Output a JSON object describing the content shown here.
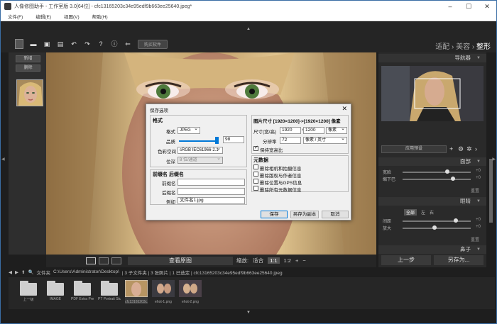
{
  "window": {
    "title": "人像修图助手 - 工作室版 3.0[64位] - cfc13165203c34e95edf9b663ee25640.jpeg*"
  },
  "menu": [
    "文件(F)",
    "编辑(E)",
    "视图(V)",
    "帮助(H)"
  ],
  "toolbar": {
    "buy_label": "购买软件"
  },
  "nav": {
    "step1": "适配",
    "sep": "›",
    "step2": "美容",
    "step3": "整形"
  },
  "left": {
    "new_label": "新增",
    "delete_label": "删除"
  },
  "view": {
    "look_label": "查看原图",
    "zoom_label": "缩放:",
    "fit": "适合",
    "one": "1:1",
    "half": "1:2",
    "plus": "+",
    "minus": "−"
  },
  "right": {
    "navigator": "导航器",
    "preset": "应用预设",
    "face": {
      "title": "面部",
      "rows": [
        {
          "label": "宽脸",
          "value": "+0"
        },
        {
          "label": "缩下巴",
          "value": "+0"
        }
      ],
      "reset": "重置"
    },
    "eyes": {
      "title": "眼睛",
      "tab_left": "左",
      "tab_right": "右",
      "tab_both": "全部",
      "rows": [
        {
          "label": "间距",
          "value": "+0"
        },
        {
          "label": "放大",
          "value": "+0"
        }
      ],
      "reset": "重置"
    },
    "nose": {
      "title": "鼻子"
    },
    "back": "上一步",
    "save": "另存为..."
  },
  "path": {
    "label": "文件夹",
    "value": "C:\\Users\\Administrator\\Desktop\\",
    "info": "| 3 子文件夹 | 3 张照片 | 1 已选定 | cfc13165203c34e95edf9b663ee25640.jpeg"
  },
  "film": [
    {
      "name": "上一级"
    },
    {
      "name": "IMAGE"
    },
    {
      "name": "PDF Extra Pre..."
    },
    {
      "name": "PT Portrait Stu..."
    },
    {
      "name": "cfc13165203c..."
    },
    {
      "name": "ehot-1.png"
    },
    {
      "name": "ehot-2.png"
    }
  ],
  "dialog": {
    "title": "保存选项",
    "close": "✕",
    "format_head": "格式",
    "format_label": "格式",
    "format_value": "JPEG",
    "quality_label": "品质",
    "quality_value": "98",
    "colorspace_label": "色彩空间",
    "colorspace_value": "sRGB IEC61966-2.1",
    "depth_label": "位深",
    "depth_value": "8 位/通道",
    "name_head": "前缀名 后缀名",
    "prefix_label": "前缀名",
    "suffix_label": "后缀名",
    "example_label": "例如",
    "example_value": "文件名1.jpg",
    "size_head": "图片尺寸 [1920×1200]->[1920×1200] 像素",
    "size_label": "尺寸(宽/高)",
    "width_value": "1920",
    "x_sep": "×",
    "height_value": "1200",
    "unit_value": "像素",
    "res_label": "分辨率",
    "res_value": "72",
    "res_unit_value": "像素 / 英寸",
    "keep_ratio": "保持宽高比",
    "meta_head": "元数据",
    "meta_items": [
      "删除相机和拍摄信息",
      "删除版权与作者信息",
      "删除位置与GPS信息",
      "删除所有元数据信息"
    ],
    "btn_save": "保存",
    "btn_copy": "另存为副本",
    "btn_cancel": "取消"
  }
}
